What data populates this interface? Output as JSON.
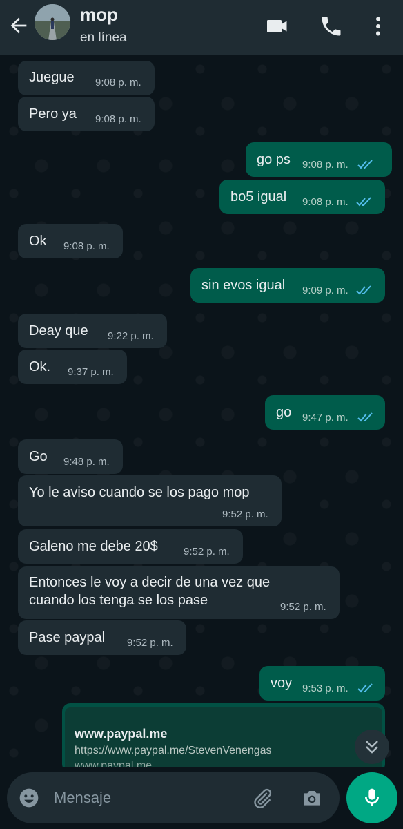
{
  "header": {
    "contact_name": "mop",
    "status": "en línea"
  },
  "messages": [
    {
      "dir": "in",
      "text": "Juegue",
      "time": "9:08 p. m."
    },
    {
      "dir": "in",
      "text": "Pero ya",
      "time": "9:08 p. m."
    },
    {
      "dir": "out",
      "text": "go ps",
      "time": "9:08 p. m."
    },
    {
      "dir": "out",
      "text": "bo5 igual",
      "time": "9:08 p. m."
    },
    {
      "dir": "in",
      "text": "Ok",
      "time": "9:08 p. m."
    },
    {
      "dir": "out",
      "text": "sin evos igual",
      "time": "9:09 p. m."
    },
    {
      "dir": "in",
      "text": "Deay que",
      "time": "9:22 p. m."
    },
    {
      "dir": "in",
      "text": "Ok.",
      "time": "9:37 p. m."
    },
    {
      "dir": "out",
      "text": "go",
      "time": "9:47 p. m."
    },
    {
      "dir": "in",
      "text": "Go",
      "time": "9:48 p. m."
    },
    {
      "dir": "in",
      "text": "Yo le aviso cuando se los pago mop",
      "time": "9:52 p. m."
    },
    {
      "dir": "in",
      "text": "Galeno me debe 20$",
      "time": "9:52 p. m."
    },
    {
      "dir": "in",
      "text": "Entonces le voy a decir de una vez que cuando los tenga se los pase",
      "time": "9:52 p. m."
    },
    {
      "dir": "in",
      "text": "Pase paypal",
      "time": "9:52 p. m."
    },
    {
      "dir": "out",
      "text": "voy",
      "time": "9:53 p. m."
    }
  ],
  "link_preview": {
    "title": "www.paypal.me",
    "url": "https://www.paypal.me/StevenVenengas",
    "sub": "www.paypal.me"
  },
  "composer": {
    "placeholder": "Mensaje"
  },
  "colors": {
    "header_bg": "#1f2c33",
    "incoming_bubble": "#1f2c33",
    "outgoing_bubble": "#005c4b",
    "read_tick": "#53bdeb",
    "mic_button": "#00a884"
  },
  "icons": [
    "back-arrow-icon",
    "video-call-icon",
    "phone-icon",
    "more-vert-icon",
    "read-receipt-icon",
    "chevron-double-down-icon",
    "emoji-icon",
    "attach-icon",
    "camera-icon",
    "mic-icon"
  ]
}
